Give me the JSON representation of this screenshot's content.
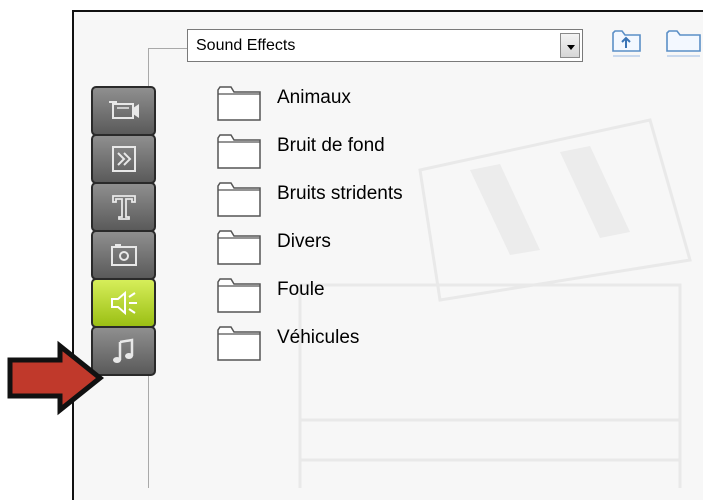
{
  "library_dropdown": {
    "selected": "Sound Effects"
  },
  "toolbar": {
    "up_folder_icon": "folder-up-icon",
    "new_folder_icon": "folder-icon"
  },
  "side_tabs": [
    {
      "icon": "video-camera-icon",
      "active": false
    },
    {
      "icon": "transition-icon",
      "active": false
    },
    {
      "icon": "title-text-icon",
      "active": false
    },
    {
      "icon": "photo-icon",
      "active": false
    },
    {
      "icon": "speaker-icon",
      "active": true
    },
    {
      "icon": "music-note-icon",
      "active": false
    }
  ],
  "folders": [
    {
      "label": "Animaux"
    },
    {
      "label": "Bruit de fond"
    },
    {
      "label": "Bruits stridents"
    },
    {
      "label": "Divers"
    },
    {
      "label": "Foule"
    },
    {
      "label": "Véhicules"
    }
  ],
  "colors": {
    "active_tab": "#b5d630",
    "tab": "#747474",
    "pointer_arrow": "#c0392b"
  }
}
